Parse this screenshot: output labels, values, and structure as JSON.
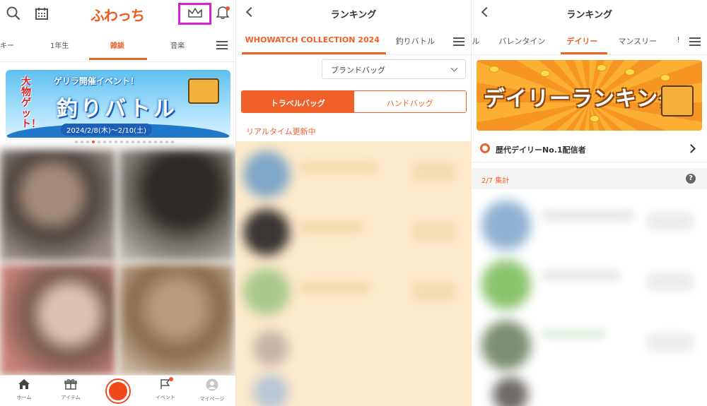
{
  "panel1": {
    "logo": "ふわっち",
    "tabs": [
      "キー",
      "1年生",
      "雑談",
      "音楽"
    ],
    "active_tab": "雑談",
    "banner": {
      "subtitle": "ゲリラ開催イベント！",
      "title": "釣りバトル",
      "side_text": "大物ゲット！",
      "dates": "2024/2/8(木)〜2/10(土)"
    },
    "carousel": {
      "count": 18,
      "active_index": 3
    },
    "bottom_nav": {
      "home": "ホーム",
      "item": "アイテム",
      "event": "イベント",
      "mypage": "マイページ"
    },
    "icons": [
      "search-icon",
      "calendar-icon",
      "crown-icon",
      "bell-icon",
      "hamburger-icon"
    ],
    "highlight_color": "#d71fd4",
    "accent_color": "#f0612a"
  },
  "panel2": {
    "title": "ランキング",
    "tabs": [
      "WHOWATCH COLLECTION 2024",
      "釣りバトル"
    ],
    "active_tab": "WHOWATCH COLLECTION 2024",
    "select_value": "ブランドバッグ",
    "segments": {
      "left": "トラベルバッグ",
      "right": "ハンドバッグ",
      "selected": "トラベルバッグ"
    },
    "realtime_label": "リアルタイム更新中"
  },
  "panel3": {
    "title": "ランキング",
    "tabs": [
      "ル",
      "バレンタイン",
      "デイリー",
      "マンスリー",
      "!"
    ],
    "active_tab": "デイリー",
    "banner_text": "デイリーランキング",
    "history_label": "歴代デイリーNo.1配信者",
    "aggregate_label": "2/7 集計"
  }
}
